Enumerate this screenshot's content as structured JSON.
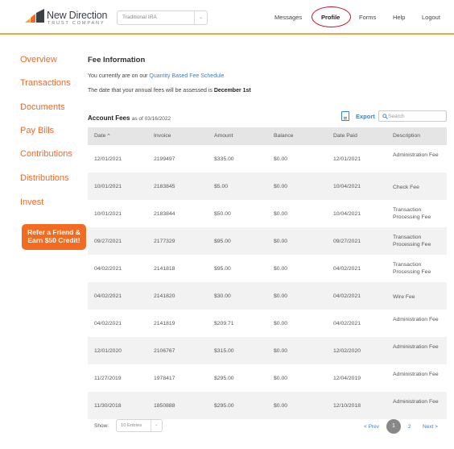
{
  "header": {
    "logo_name": "New Direction",
    "logo_sub": "TRUST COMPANY",
    "account_select": "Traditional IRA",
    "nav": {
      "messages": "Messages",
      "profile": "Profile",
      "forms": "Forms",
      "help": "Help",
      "logout": "Logout"
    }
  },
  "sidebar": {
    "items": [
      {
        "label": "Overview"
      },
      {
        "label": "Transactions"
      },
      {
        "label": "Documents"
      },
      {
        "label": "Pay Bills"
      },
      {
        "label": "Contributions"
      },
      {
        "label": "Distributions"
      },
      {
        "label": "Invest"
      }
    ],
    "refer_line1": "Refer a Friend &",
    "refer_line2": "Earn $50 Credit!"
  },
  "main": {
    "title": "Fee Information",
    "line1_prefix": "You currently are on our",
    "line1_link": "Quantity Based Fee Schedule",
    "line2_prefix": "The date that your annual fees will be assessed is",
    "line2_bold": "December 1st",
    "account_fees_label": "Account Fees",
    "as_of": "as of 03/16/2022",
    "export_label": "Export",
    "search_placeholder": "Search"
  },
  "table": {
    "headers": {
      "date": "Date ^",
      "invoice": "Invoice",
      "amount": "Amount",
      "balance": "Balance",
      "date_paid": "Date Paid",
      "description": "Description"
    },
    "rows": [
      {
        "date": "12/01/2021",
        "invoice": "2199497",
        "amount": "$335.00",
        "balance": "$0.00",
        "date_paid": "12/01/2021",
        "description": "Administration Fee"
      },
      {
        "date": "10/01/2021",
        "invoice": "2183845",
        "amount": "$5.00",
        "balance": "$0.00",
        "date_paid": "10/04/2021",
        "description": "Check Fee"
      },
      {
        "date": "10/01/2021",
        "invoice": "2183844",
        "amount": "$50.00",
        "balance": "$0.00",
        "date_paid": "10/04/2021",
        "description": "Transaction Processing Fee"
      },
      {
        "date": "09/27/2021",
        "invoice": "2177329",
        "amount": "$95.00",
        "balance": "$0.00",
        "date_paid": "09/27/2021",
        "description": "Transaction Processing Fee"
      },
      {
        "date": "04/02/2021",
        "invoice": "2141818",
        "amount": "$95.00",
        "balance": "$0.00",
        "date_paid": "04/02/2021",
        "description": "Transaction Processing Fee"
      },
      {
        "date": "04/02/2021",
        "invoice": "2141820",
        "amount": "$30.00",
        "balance": "$0.00",
        "date_paid": "04/02/2021",
        "description": "Wire Fee"
      },
      {
        "date": "04/02/2021",
        "invoice": "2141819",
        "amount": "$209.71",
        "balance": "$0.00",
        "date_paid": "04/02/2021",
        "description": "Administration Fee"
      },
      {
        "date": "12/01/2020",
        "invoice": "2106767",
        "amount": "$315.00",
        "balance": "$0.00",
        "date_paid": "12/02/2020",
        "description": "Administration Fee"
      },
      {
        "date": "11/27/2019",
        "invoice": "1978417",
        "amount": "$295.00",
        "balance": "$0.00",
        "date_paid": "12/04/2019",
        "description": "Administration Fee"
      },
      {
        "date": "11/30/2018",
        "invoice": "1850888",
        "amount": "$295.00",
        "balance": "$0.00",
        "date_paid": "12/10/2018",
        "description": "Administration Fee"
      }
    ]
  },
  "footer": {
    "show_label": "Show:",
    "entries_value": "10 Entries",
    "prev": "< Prev",
    "page_current": "1",
    "page_2": "2",
    "next": "Next >"
  },
  "colors": {
    "accent_orange": "#f26b21",
    "link_blue": "#3b82c4",
    "header_rule": "#f4a340",
    "profile_circle": "#c8102e"
  },
  "icons": {
    "logo": "new-direction-logo-icon",
    "export": "document-icon",
    "search": "search-icon",
    "dropdown": "chevron-down-icon"
  }
}
